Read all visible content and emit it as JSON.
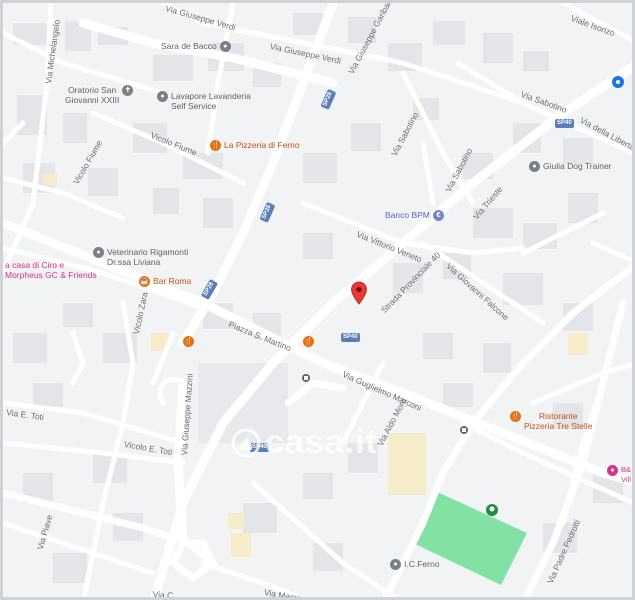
{
  "map": {
    "watermark": "casa.it",
    "pin_color": "#e53935",
    "park_color": "#81e2a3",
    "road_color": "#ffffff",
    "block_color": "#e6e8eb",
    "street_labels": {
      "via_giuseppe_verdi": "Via Giuseppe Verdi",
      "via_giuseppe_garibaldi": "Via Giuseppe Garibaldi",
      "via_michelangelo": "Via Michelangelo",
      "vicolo_fiume_top": "Vicolo Fiume",
      "vicolo_fiume_left": "Vicolo Fiume",
      "via_sabotino_1": "Via Sabotino",
      "via_sabotino_2": "Via Sabotino",
      "via_sabotino_3": "Via Sabotino",
      "viale_isonzo": "Viale Isonzo",
      "via_della_liberta": "Via della Libertà",
      "via_trieste": "Via Trieste",
      "via_vittorio_veneto": "Via Vittorio Veneto",
      "via_giovanni_falcone": "Via Giovanni Falcone",
      "strada_provinciale_40": "Strada Provinciale 40",
      "piazza_s_martino": "Piazza S. Martino",
      "via_guglielmo_marconi": "Via Guglielmo Marconi",
      "via_aldo_moro": "Via Aldo Moro",
      "vicolo_zara": "Vicolo Zara",
      "vicolo_e_toti": "Vicolo E. Toti",
      "via_e_toti": "Via E. Toti",
      "via_giuseppe_mazzini": "Via Giuseppe Mazzini",
      "via_piave": "Via Piave",
      "via_padre_pedrotti": "Via Padre Pedrotti",
      "via_marco": "Via Marco",
      "via_c": "Via C"
    },
    "road_shields": {
      "sp28_a": "SP28",
      "sp28_b": "SP28",
      "sp28_c": "SP28",
      "sp40_a": "SP40",
      "sp40_b": "SP40",
      "sp40_c": "SP40"
    },
    "pois": {
      "sara_di_bacco": "Sara de Bacco",
      "oratorio": "Oratorio San\nGiovanni XXIII",
      "lavapore": "Lavapore Lavanderia\nSelf Service",
      "la_pizzeria": "La Pizzeria di Ferno",
      "giulia_dog": "Giulia Dog Trainer",
      "banco_bpm": "Banco BPM",
      "veterinario": "Veterinario Rigamonti\nDr.ssa Liviana",
      "casa_di_ciro": "a casa di Ciro e\nMorpheus GC & Friends",
      "bar_roma": "Bar Roma",
      "ristorante": "Ristorante\nPizzeria Tre Stelle",
      "ic_ferno": "I.C.Ferno",
      "b_and": "B&\nVill"
    }
  }
}
